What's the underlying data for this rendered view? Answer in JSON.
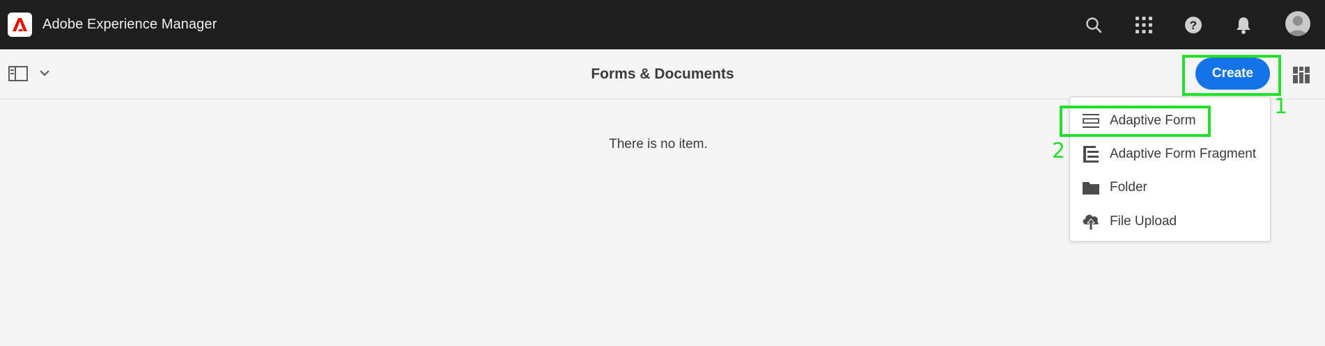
{
  "app": {
    "title": "Adobe Experience Manager"
  },
  "shell": {
    "icons": [
      "search-icon",
      "apps-grid-icon",
      "help-icon",
      "notifications-bell-icon",
      "user-avatar"
    ]
  },
  "actionbar": {
    "title": "Forms & Documents",
    "create_label": "Create"
  },
  "content": {
    "empty_message": "There is no item."
  },
  "create_menu": {
    "items": [
      {
        "label": "Adaptive Form",
        "icon": "adaptive-form-icon"
      },
      {
        "label": "Adaptive Form Fragment",
        "icon": "form-fragment-icon"
      },
      {
        "label": "Folder",
        "icon": "folder-icon"
      },
      {
        "label": "File Upload",
        "icon": "cloud-upload-icon"
      }
    ]
  },
  "annotations": {
    "step1": "1",
    "step2": "2",
    "color": "#22e02a"
  },
  "colors": {
    "accent": "#1473e6",
    "shell": "#1e1e1e",
    "brand_red": "#eb1000"
  }
}
